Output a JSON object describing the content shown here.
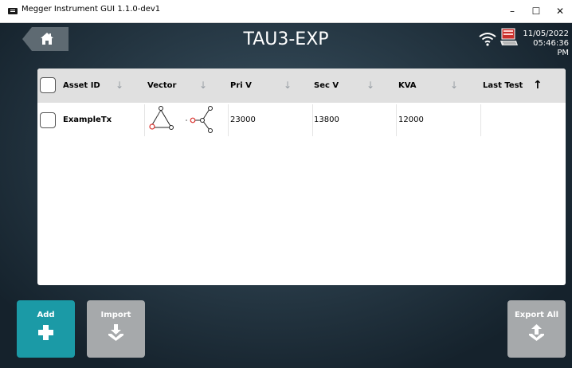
{
  "window": {
    "title": "Megger Instrument GUI 1.1.0-dev1",
    "minimize": "–",
    "maximize": "☐",
    "close": "✕"
  },
  "header": {
    "title": "TAU3-EXP",
    "date": "11/05/2022",
    "time": "05:46:36 PM"
  },
  "table": {
    "columns": [
      {
        "label": "Asset ID",
        "sort": "↓"
      },
      {
        "label": "Vector",
        "sort": "↓"
      },
      {
        "label": "Pri V",
        "sort": "↓"
      },
      {
        "label": "Sec V",
        "sort": "↓"
      },
      {
        "label": "KVA",
        "sort": "↓"
      },
      {
        "label": "Last Test",
        "sort": "↑"
      }
    ],
    "rows": [
      {
        "asset_id": "ExampleTx",
        "vector": "delta-wye",
        "pri_v": "23000",
        "sec_v": "13800",
        "kva": "12000",
        "last_test": ""
      }
    ]
  },
  "footer": {
    "add": "Add",
    "import": "Import",
    "export_all": "Export All"
  },
  "colors": {
    "accent": "#1b9aa6",
    "disabled": "#a6a9ab",
    "vector_marker": "#d9302c"
  },
  "icons": [
    "home-icon",
    "wifi-icon",
    "lcd-status-icon",
    "plus-icon",
    "import-icon",
    "export-icon",
    "sort-arrow-icon"
  ]
}
